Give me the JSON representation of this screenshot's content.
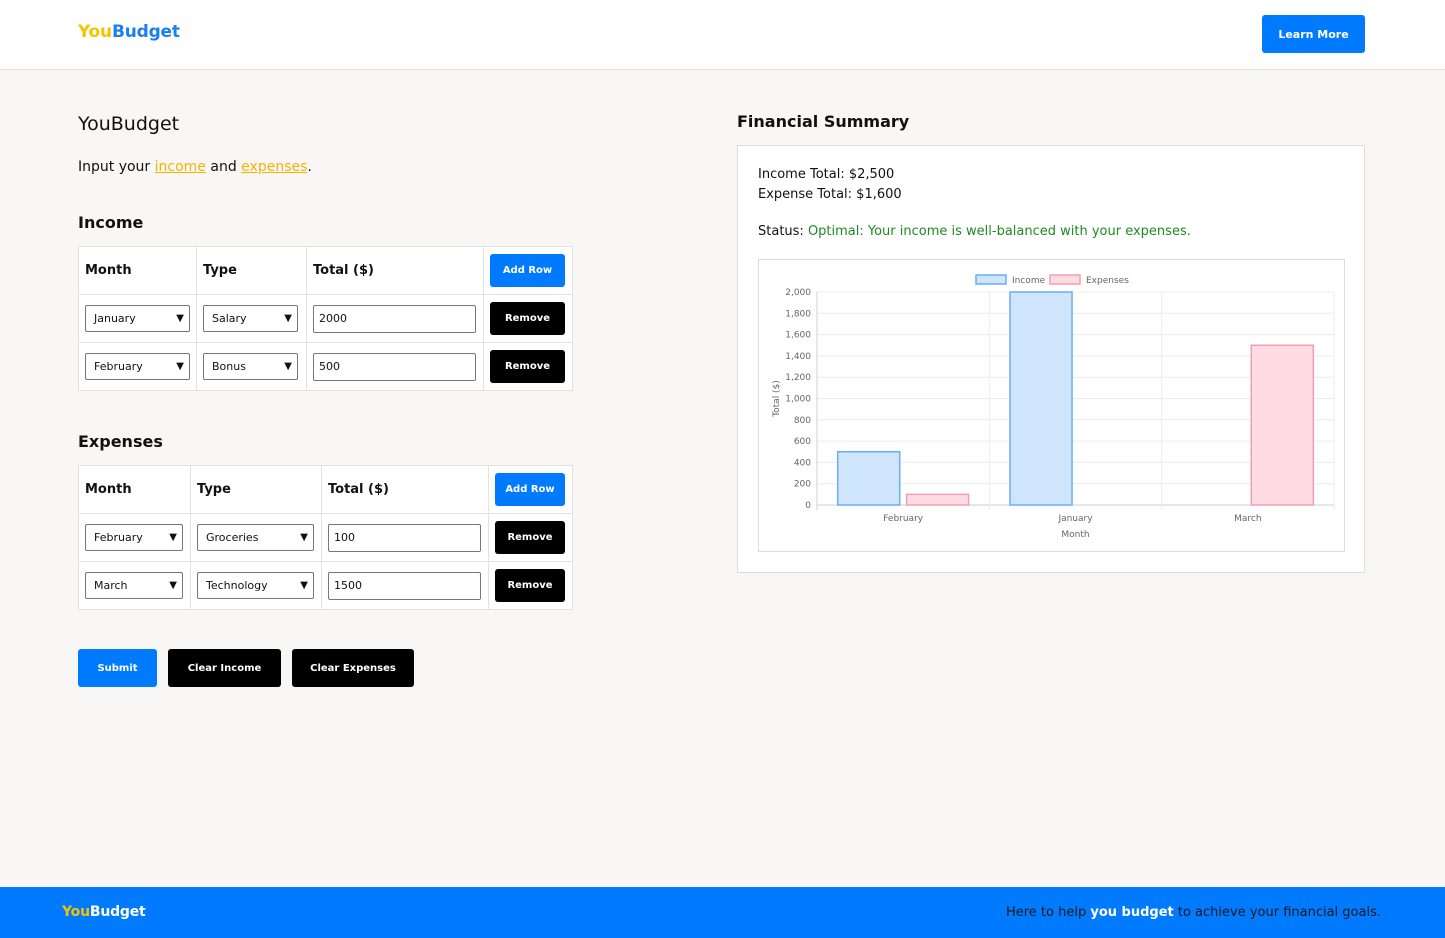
{
  "brand": {
    "part1": "You",
    "part2": "Budget"
  },
  "header": {
    "learn_more": "Learn More"
  },
  "main": {
    "title": "YouBudget",
    "intro_prefix": "Input your ",
    "intro_link_income": "income",
    "intro_and": " and ",
    "intro_link_expenses": "expenses",
    "intro_suffix": "."
  },
  "income": {
    "title": "Income",
    "headers": {
      "month": "Month",
      "type": "Type",
      "total": "Total ($)"
    },
    "add_row": "Add Row",
    "rows": [
      {
        "month": "January",
        "type": "Salary",
        "total": "2000",
        "remove": "Remove"
      },
      {
        "month": "February",
        "type": "Bonus",
        "total": "500",
        "remove": "Remove"
      }
    ]
  },
  "expenses": {
    "title": "Expenses",
    "headers": {
      "month": "Month",
      "type": "Type",
      "total": "Total ($)"
    },
    "add_row": "Add Row",
    "rows": [
      {
        "month": "February",
        "type": "Groceries",
        "total": "100",
        "remove": "Remove"
      },
      {
        "month": "March",
        "type": "Technology",
        "total": "1500",
        "remove": "Remove"
      }
    ]
  },
  "actions": {
    "submit": "Submit",
    "clear_income": "Clear Income",
    "clear_expenses": "Clear Expenses"
  },
  "summary": {
    "title": "Financial Summary",
    "income_total": "Income Total: $2,500",
    "expense_total": "Expense Total: $1,600",
    "status_label": "Status: ",
    "status_value": "Optimal: Your income is well-balanced with your expenses."
  },
  "footer": {
    "tag_before": "Here to help ",
    "tag_bold": "you budget",
    "tag_after": " to achieve your financial goals."
  },
  "colors": {
    "accent_blue": "#007bff",
    "brand_yellow": "#f5c400",
    "status_green": "#1f8a1f",
    "income_fill": "#cfe5fb",
    "income_stroke": "#6aaef0",
    "expense_fill": "#ffdce3",
    "expense_stroke": "#f29fb1"
  },
  "chart_data": {
    "type": "bar",
    "categories": [
      "February",
      "January",
      "March"
    ],
    "series": [
      {
        "name": "Income",
        "values": [
          500,
          2000,
          0
        ]
      },
      {
        "name": "Expenses",
        "values": [
          100,
          0,
          1500
        ]
      }
    ],
    "xlabel": "Month",
    "ylabel": "Total ($)",
    "ylim": [
      0,
      2000
    ],
    "yticks": [
      "0",
      "200",
      "400",
      "600",
      "800",
      "1,000",
      "1,200",
      "1,400",
      "1,600",
      "1,800",
      "2,000"
    ],
    "legend": "top-center",
    "grid": true
  }
}
